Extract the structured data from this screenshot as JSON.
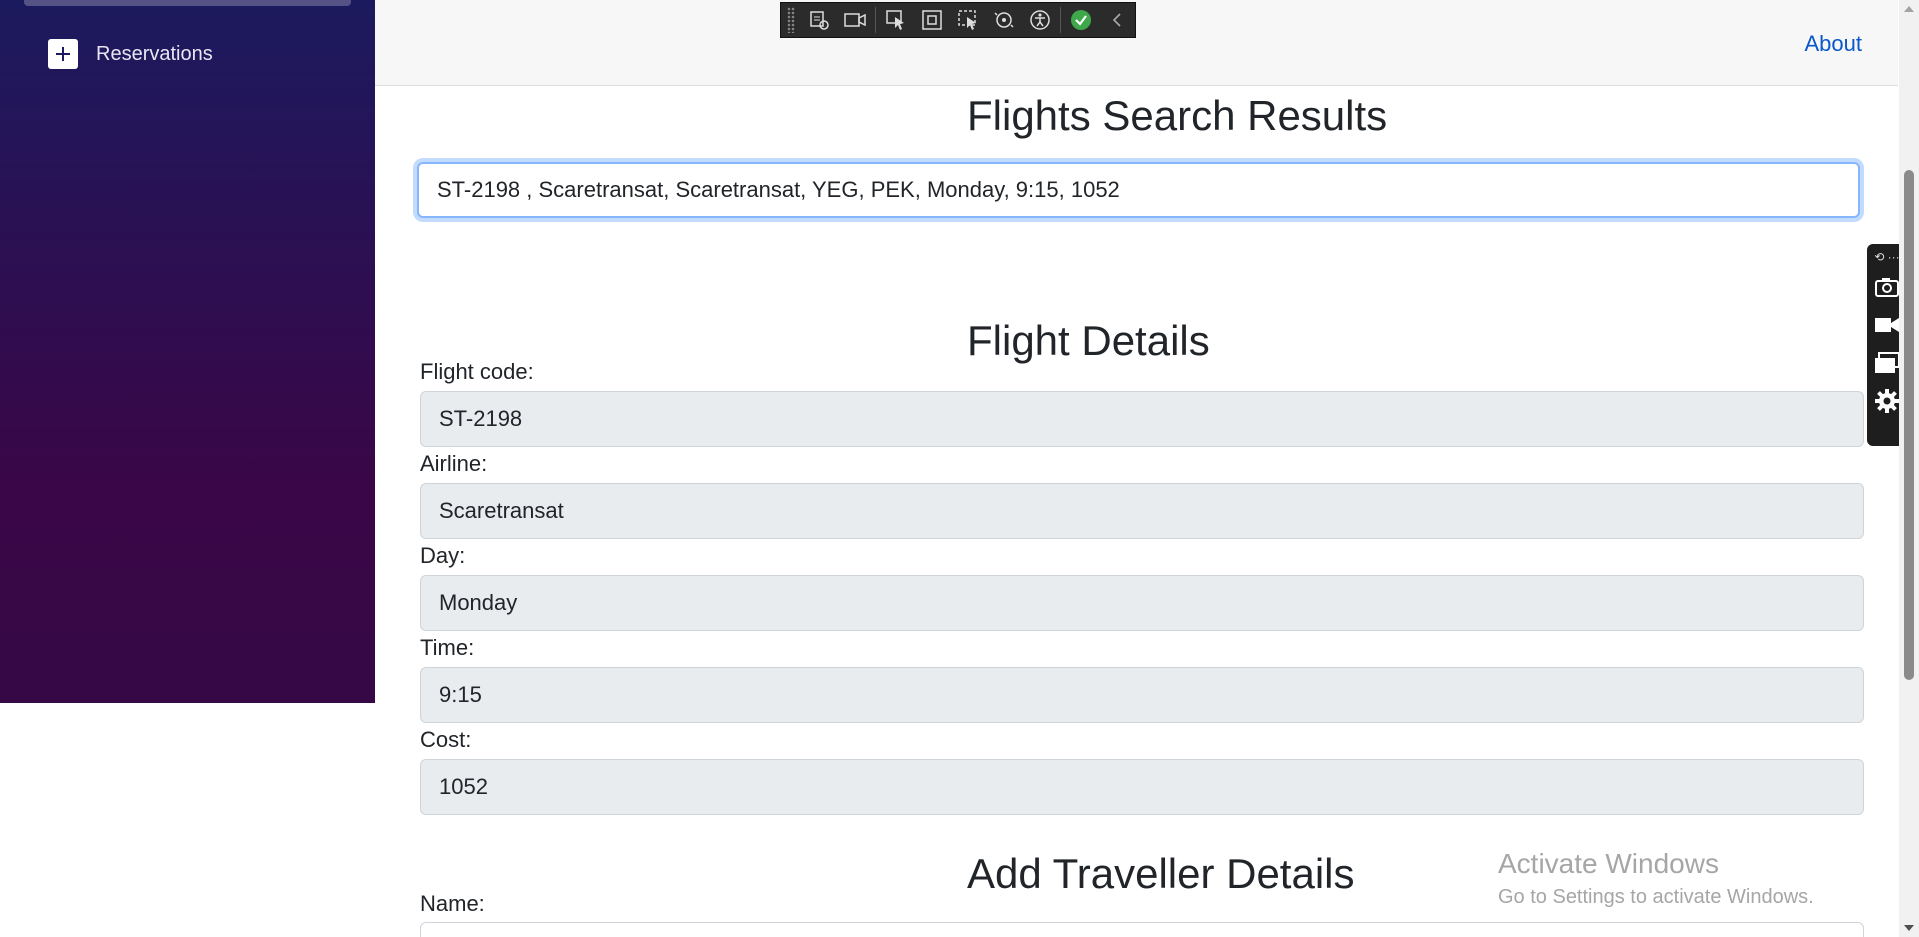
{
  "sidebar": {
    "items": [
      {
        "label": "Reservations",
        "icon": "plus-icon"
      }
    ]
  },
  "header": {
    "about_label": "About"
  },
  "search_results": {
    "title": "Flights Search Results",
    "selected": "ST-2198 , Scaretransat, Scaretransat, YEG, PEK, Monday, 9:15, 1052"
  },
  "flight_details": {
    "title": "Flight Details",
    "fields": [
      {
        "label": "Flight code:",
        "value": "ST-2198"
      },
      {
        "label": "Airline:",
        "value": "Scaretransat"
      },
      {
        "label": "Day:",
        "value": "Monday"
      },
      {
        "label": "Time:",
        "value": "9:15"
      },
      {
        "label": "Cost:",
        "value": "1052"
      }
    ]
  },
  "traveller": {
    "title": "Add Traveller Details",
    "name_label": "Name:",
    "name_value": ""
  },
  "watermark": {
    "title": "Activate Windows",
    "subtitle": "Go to Settings to activate Windows."
  },
  "colors": {
    "sidebar_top": "#1c1a5e",
    "sidebar_bottom": "#360845",
    "link": "#0a58ca",
    "readonly_bg": "#e9ecef",
    "focus_border": "#86b7fe"
  }
}
